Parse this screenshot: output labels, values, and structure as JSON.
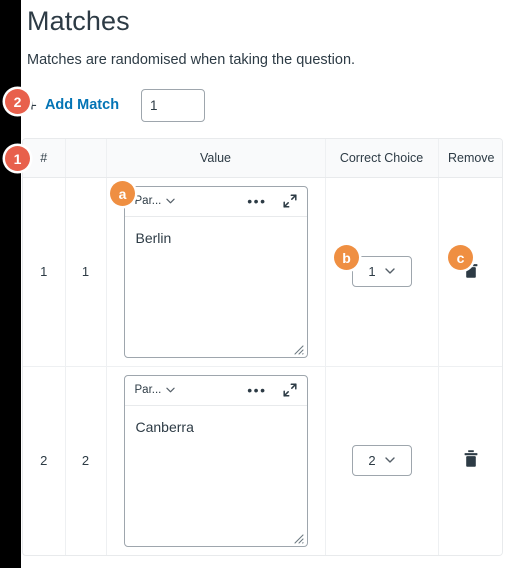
{
  "header": {
    "title": "Matches",
    "subtitle": "Matches are randomised when taking the question."
  },
  "toolbar": {
    "plus": "+",
    "add_match_label": "Add Match",
    "count_value": "1",
    "count_placeholder": ""
  },
  "table": {
    "columns": [
      "#",
      "",
      "Value",
      "Correct Choice",
      "Remove"
    ],
    "rows": [
      {
        "number": "1",
        "index": "1",
        "editor": {
          "format_label": "Par...",
          "caret": "⌄",
          "more_label": "•••",
          "text": "Berlin"
        },
        "correct_choice": "1",
        "choice_caret": "⌄",
        "remove_label": ""
      },
      {
        "number": "2",
        "index": "2",
        "editor": {
          "format_label": "Par...",
          "caret": "⌄",
          "more_label": "•••",
          "text": "Canberra"
        },
        "correct_choice": "2",
        "choice_caret": "⌄",
        "remove_label": ""
      }
    ]
  },
  "annotations": [
    {
      "id": "1",
      "label": "1",
      "color": "#e8604c"
    },
    {
      "id": "2",
      "label": "2",
      "color": "#e8604c"
    },
    {
      "id": "a",
      "label": "a",
      "color": "#ef8f42"
    },
    {
      "id": "b",
      "label": "b",
      "color": "#ef8f42"
    },
    {
      "id": "c",
      "label": "c",
      "color": "#ef8f42"
    }
  ],
  "colors": {
    "link": "#0374b5",
    "text": "#2d3b45",
    "border": "#9ea6ad",
    "table_border": "#e8eaec",
    "header_bg": "#f9fafb",
    "badge_red": "#e8604c",
    "badge_orange": "#ef8f42"
  }
}
